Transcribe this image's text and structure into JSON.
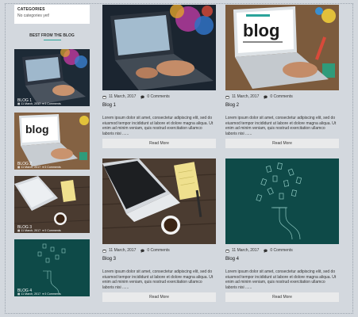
{
  "sidebar": {
    "categories_title": "CATEGORIES",
    "categories_empty": "No categories yet!",
    "best_title": "BEST FROM THE BLOG",
    "cards": [
      {
        "caption": "BLOG 1",
        "date": "11 March, 2017",
        "comments": "0 Comments"
      },
      {
        "caption": "BLOG 2",
        "date": "11 March, 2017",
        "comments": "0 Comments"
      },
      {
        "caption": "BLOG 3",
        "date": "11 March, 2017",
        "comments": "0 Comments"
      },
      {
        "caption": "BLOG 4",
        "date": "11 March, 2017",
        "comments": "0 Comments"
      }
    ]
  },
  "posts": [
    {
      "date": "11 March, 2017",
      "comments": "0 Comments",
      "title": "Blog 1",
      "excerpt": "Lorem ipsum dolor sit amet, consectetur adipiscing elit, sed do eiusmod tempor incididunt ut labore et dolore magna aliqua. Ut enim ad minim veniam, quis nostrud exercitation ullamco laboris nisi ......",
      "button": "Read More"
    },
    {
      "date": "11 March, 2017",
      "comments": "0 Comments",
      "title": "Blog 2",
      "excerpt": "Lorem ipsum dolor sit amet, consectetur adipiscing elit, sed do eiusmod tempor incididunt ut labore et dolore magna aliqua. Ut enim ad minim veniam, quis nostrud exercitation ullamco laboris nisi ......",
      "button": "Read More"
    },
    {
      "date": "11 March, 2017",
      "comments": "0 Comments",
      "title": "Blog 3",
      "excerpt": "Lorem ipsum dolor sit amet, consectetur adipiscing elit, sed do eiusmod tempor incididunt ut labore et dolore magna aliqua. Ut enim ad minim veniam, quis nostrud exercitation ullamco laboris nisi ......",
      "button": "Read More"
    },
    {
      "date": "11 March, 2017",
      "comments": "0 Comments",
      "title": "Blog 4",
      "excerpt": "Lorem ipsum dolor sit amet, consectetur adipiscing elit, sed do eiusmod tempor incididunt ut labore et dolore magna aliqua. Ut enim ad minim veniam, quis nostrud exercitation ullamco laboris nisi ......",
      "button": "Read More"
    }
  ],
  "images": {
    "blog_logo_text": "blog"
  },
  "colors": {
    "page_bg": "#d3d8de",
    "accent": "#2aa39a",
    "teal_card": "#0e4a48",
    "button_bg": "#e9eaeb"
  }
}
